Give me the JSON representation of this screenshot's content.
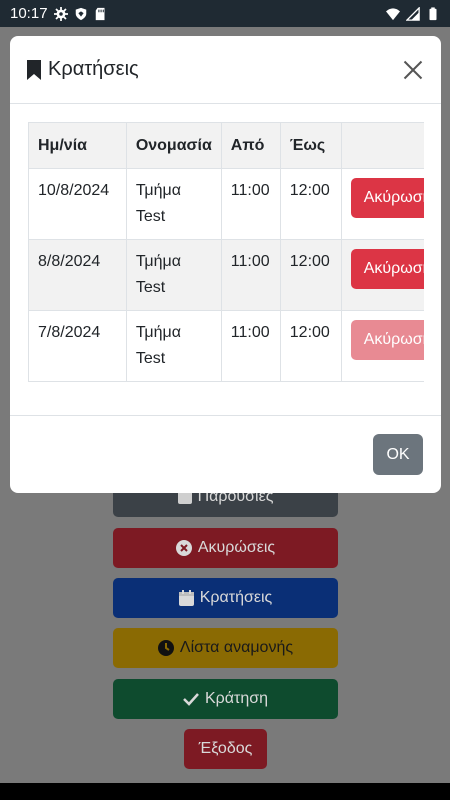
{
  "status_bar": {
    "time": "10:17"
  },
  "background_buttons": [
    {
      "label": "Παρουσίες",
      "icon": "check-square-icon"
    },
    {
      "label": "Ακυρώσεις",
      "icon": "x-circle-icon"
    },
    {
      "label": "Κρατήσεις",
      "icon": "calendar-icon"
    },
    {
      "label": "Λίστα αναμονής",
      "icon": "clock-icon"
    },
    {
      "label": "Κράτηση",
      "icon": "check-icon"
    },
    {
      "label": "Έξοδος",
      "icon": ""
    }
  ],
  "modal": {
    "title": "Κρατήσεις",
    "title_icon": "bookmark-icon",
    "columns": [
      "Ημ/νία",
      "Ονομασία",
      "Από",
      "Έως",
      ""
    ],
    "rows": [
      {
        "date": "10/8/2024",
        "name": "Τμήμα Test",
        "from": "11:00",
        "to": "12:00",
        "action": "Ακύρωση"
      },
      {
        "date": "8/8/2024",
        "name": "Τμήμα Test",
        "from": "11:00",
        "to": "12:00",
        "action": "Ακύρωση"
      },
      {
        "date": "7/8/2024",
        "name": "Τμήμα Test",
        "from": "11:00",
        "to": "12:00",
        "action": "Ακύρωση"
      }
    ],
    "ok_label": "OK"
  }
}
